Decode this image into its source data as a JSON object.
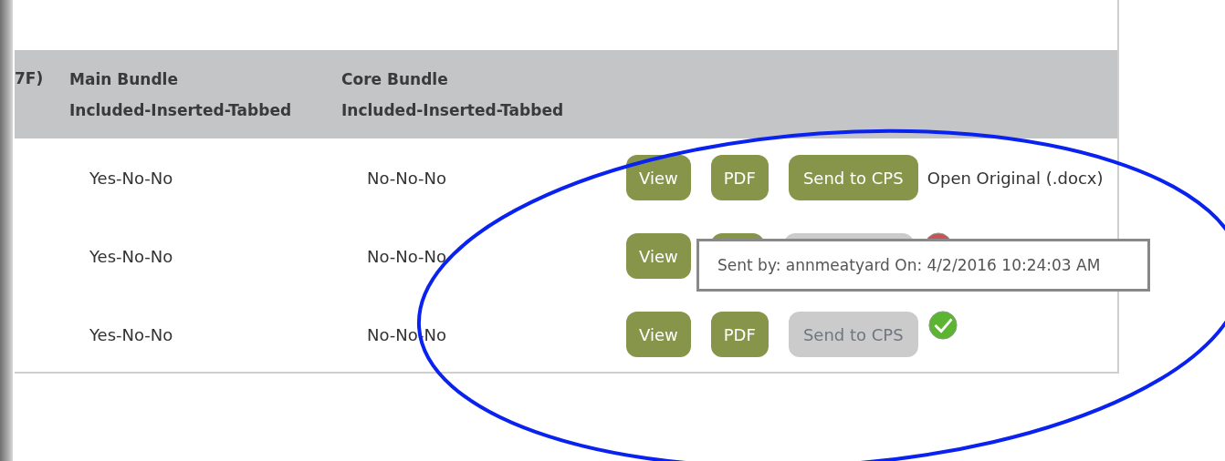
{
  "table": {
    "columns": [
      "7F)",
      "Main Bundle\nIncluded-Inserted-Tabbed",
      "Core Bundle\nIncluded-Inserted-Tabbed"
    ],
    "rows": [
      {
        "main_bundle": "Yes-No-No",
        "core_bundle": "No-No-No",
        "actions": [
          {
            "kind": "view",
            "label": "View",
            "disabled": false
          },
          {
            "kind": "pdf",
            "label": "PDF",
            "disabled": false
          },
          {
            "kind": "send",
            "label": "Send to CPS",
            "disabled": false
          }
        ],
        "status": {
          "kind": "link",
          "text": "Open Original (.docx)"
        }
      },
      {
        "main_bundle": "Yes-No-No",
        "core_bundle": "No-No-No",
        "actions": [
          {
            "kind": "view",
            "label": "View",
            "disabled": false
          },
          {
            "kind": "pdf",
            "disabled": false
          },
          {
            "kind": "send",
            "disabled": true
          }
        ],
        "status": {
          "kind": "error"
        }
      },
      {
        "main_bundle": "Yes-No-No",
        "core_bundle": "No-No-No",
        "actions": [
          {
            "kind": "view",
            "label": "View",
            "disabled": false
          },
          {
            "kind": "pdf",
            "label": "PDF",
            "disabled": false
          },
          {
            "kind": "send",
            "label": "Send to CPS",
            "disabled": true
          }
        ],
        "status": {
          "kind": "ok"
        }
      }
    ]
  },
  "tooltip": {
    "text": "Sent by: annmeatyard On: 4/2/2016 10:24:03 AM"
  },
  "annotation": {
    "kind": "ellipse",
    "color": "#0a22f0"
  }
}
